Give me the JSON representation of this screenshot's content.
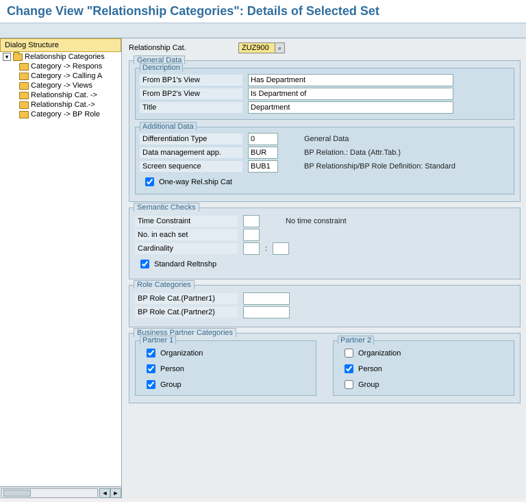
{
  "title": "Change View \"Relationship Categories\": Details of Selected Set",
  "tree_header": "Dialog Structure",
  "tree": {
    "root": "Relationship Categories",
    "children": [
      "Category -> Respons",
      "Category -> Calling A",
      "Category -> Views",
      "Relationship Cat. ->",
      "Relationship Cat.-> ",
      "Category -> BP Role"
    ]
  },
  "top": {
    "label": "Relationship Cat.",
    "value": "ZUZ900"
  },
  "general": {
    "title": "General Data",
    "description": {
      "title": "Description",
      "from_bp1_label": "From BP1's View",
      "from_bp1_value": "Has Department",
      "from_bp2_label": "From BP2's View",
      "from_bp2_value": "Is Department of",
      "title_label": "Title",
      "title_value": "Department"
    },
    "additional": {
      "title": "Additional Data",
      "diff_label": "Differentiation Type",
      "diff_value": "0",
      "diff_desc": "General Data",
      "dma_label": "Data management app.",
      "dma_value": "BUR",
      "dma_desc": "BP Relation.: Data (Attr.Tab.)",
      "seq_label": "Screen sequence",
      "seq_value": "BUB1",
      "seq_desc": "BP Relationship/BP Role Definition: Standard",
      "oneway_label": "One-way Rel.ship Cat",
      "oneway_checked": true
    }
  },
  "semantic": {
    "title": "Semantic Checks",
    "time_label": "Time Constraint",
    "time_value": "",
    "time_desc": "No time constraint",
    "no_label": "No. in each set",
    "no_value": "",
    "card_label": "Cardinality",
    "card_value1": "",
    "card_sep": ":",
    "card_value2": "",
    "std_label": "Standard Reltnshp",
    "std_checked": true
  },
  "rolecat": {
    "title": "Role Categories",
    "p1_label": "BP Role Cat.(Partner1)",
    "p1_value": "",
    "p2_label": "BP Role Cat.(Partner2)",
    "p2_value": ""
  },
  "bpcat": {
    "title": "Business Partner Categories",
    "partner1": {
      "title": "Partner 1",
      "org_label": "Organization",
      "org": true,
      "person_label": "Person",
      "person": true,
      "group_label": "Group",
      "group": true
    },
    "partner2": {
      "title": "Partner 2",
      "org_label": "Organization",
      "org": false,
      "person_label": "Person",
      "person": true,
      "group_label": "Group",
      "group": false
    }
  }
}
